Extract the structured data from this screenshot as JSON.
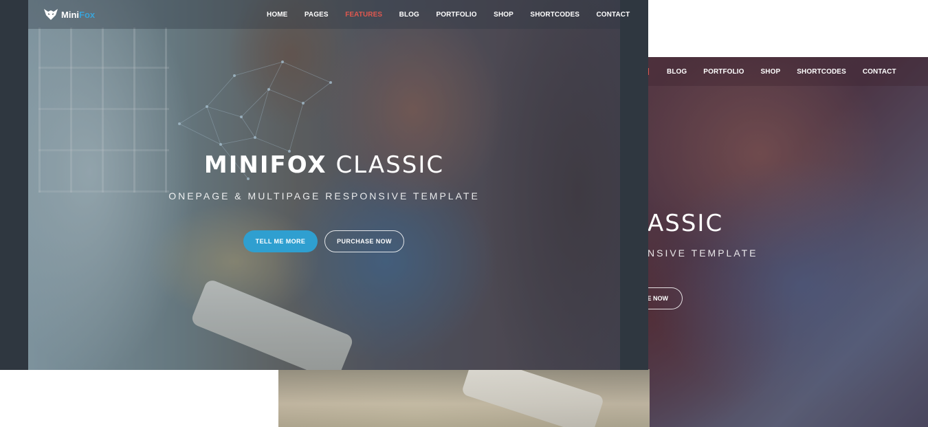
{
  "brand": {
    "name_first": "Mini",
    "name_second": "Fox",
    "accent": "#3aa3d8"
  },
  "colors": {
    "active_nav": "#e0584f",
    "primary_button": "#2f9fd0",
    "frame_dark": "#2f3740"
  },
  "front": {
    "nav": [
      {
        "label": "HOME",
        "active": false
      },
      {
        "label": "PAGES",
        "active": false
      },
      {
        "label": "FEATURES",
        "active": true
      },
      {
        "label": "BLOG",
        "active": false
      },
      {
        "label": "PORTFOLIO",
        "active": false
      },
      {
        "label": "SHOP",
        "active": false
      },
      {
        "label": "SHORTCODES",
        "active": false
      },
      {
        "label": "CONTACT",
        "active": false
      }
    ],
    "hero": {
      "title_strong": "MINIFOX",
      "title_light": "CLASSIC",
      "subtitle": "ONEPAGE & MULTIPAGE RESPONSIVE TEMPLATE",
      "btn_primary": "TELL ME MORE",
      "btn_secondary": "PURCHASE NOW"
    }
  },
  "back": {
    "nav": [
      "BLOG",
      "PORTFOLIO",
      "SHOP",
      "SHORTCODES",
      "CONTACT"
    ],
    "hero": {
      "title_partial": "ASSIC",
      "subtitle_partial": "NSIVE TEMPLATE",
      "btn_partial": "E NOW"
    }
  },
  "icons": {
    "logo": "fox-head-icon"
  }
}
